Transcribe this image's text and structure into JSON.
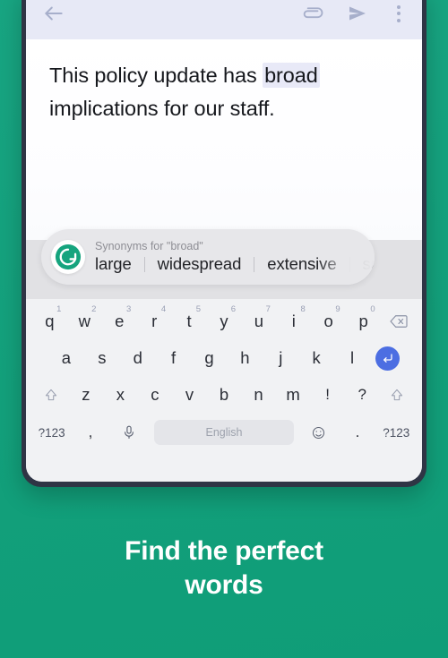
{
  "app": {
    "toolbar": {
      "back_icon": "back-arrow-icon",
      "attach_icon": "paperclip-icon",
      "send_icon": "send-icon",
      "overflow_icon": "more-vertical-icon"
    },
    "message": {
      "text_before": "This policy update has ",
      "highlighted_word": "broad",
      "text_after": " implications for our staff."
    },
    "synonyms": {
      "logo_icon": "grammarly-logo-icon",
      "title": "Synonyms for \"broad\"",
      "words": [
        "large",
        "widespread",
        "extensive",
        "sure"
      ],
      "brand_color": "#15a47e"
    },
    "keyboard": {
      "row1": [
        {
          "key": "q",
          "num": "1"
        },
        {
          "key": "w",
          "num": "2"
        },
        {
          "key": "e",
          "num": "3"
        },
        {
          "key": "r",
          "num": "4"
        },
        {
          "key": "t",
          "num": "5"
        },
        {
          "key": "y",
          "num": "6"
        },
        {
          "key": "u",
          "num": "7"
        },
        {
          "key": "i",
          "num": "8"
        },
        {
          "key": "o",
          "num": "9"
        },
        {
          "key": "p",
          "num": "0"
        }
      ],
      "backspace_icon": "backspace-icon",
      "row2": [
        "a",
        "s",
        "d",
        "f",
        "g",
        "h",
        "j",
        "k",
        "l"
      ],
      "enter_icon": "enter-icon",
      "row3_shift_icon": "shift-icon",
      "row3": [
        "z",
        "x",
        "c",
        "v",
        "b",
        "n",
        "m",
        "!",
        "?"
      ],
      "symbols_label": "?123",
      "comma": ",",
      "mic_icon": "microphone-icon",
      "space_label": "English",
      "emoji_icon": "emoji-icon",
      "period": ".",
      "enter_color": "#4c6ee2"
    }
  },
  "caption": {
    "line1": "Find the perfect",
    "line2": "words"
  }
}
